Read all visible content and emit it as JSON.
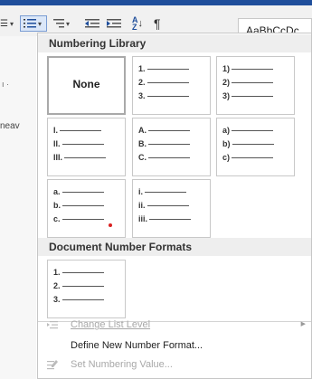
{
  "ribbon": {
    "style_preview": "AaBbCcDc",
    "buttons": [
      {
        "name": "bullets",
        "icon": "bullet-list-icon"
      },
      {
        "name": "numbering",
        "icon": "numbered-list-icon",
        "selected": true
      },
      {
        "name": "multilevel",
        "icon": "multilevel-list-icon"
      },
      {
        "name": "decrease-indent",
        "icon": "decrease-indent-icon"
      },
      {
        "name": "increase-indent",
        "icon": "increase-indent-icon"
      },
      {
        "name": "sort",
        "icon": "sort-az-icon"
      },
      {
        "name": "show-marks",
        "icon": "pilcrow-icon",
        "glyph": "¶"
      }
    ]
  },
  "document": {
    "fragment_text": "neav"
  },
  "numbering_library": {
    "title": "Numbering Library",
    "none_label": "None",
    "formats": [
      [
        "1.",
        "2.",
        "3."
      ],
      [
        "1)",
        "2)",
        "3)"
      ],
      [
        "I.",
        "II.",
        "III."
      ],
      [
        "A.",
        "B.",
        "C."
      ],
      [
        "a)",
        "b)",
        "c)"
      ],
      [
        "a.",
        "b.",
        "c."
      ],
      [
        "i.",
        "ii.",
        "iii."
      ]
    ]
  },
  "document_formats": {
    "title": "Document Number Formats",
    "formats": [
      [
        "1.",
        "2.",
        "3."
      ]
    ]
  },
  "menu": {
    "change_list_level": "Change List Level",
    "define_new_format": "Define New Number Format...",
    "set_numbering_value": "Set Numbering Value..."
  },
  "colors": {
    "accent": "#1f4e9b",
    "marker": "#d92020",
    "disabled_text": "#a8a8a8"
  }
}
